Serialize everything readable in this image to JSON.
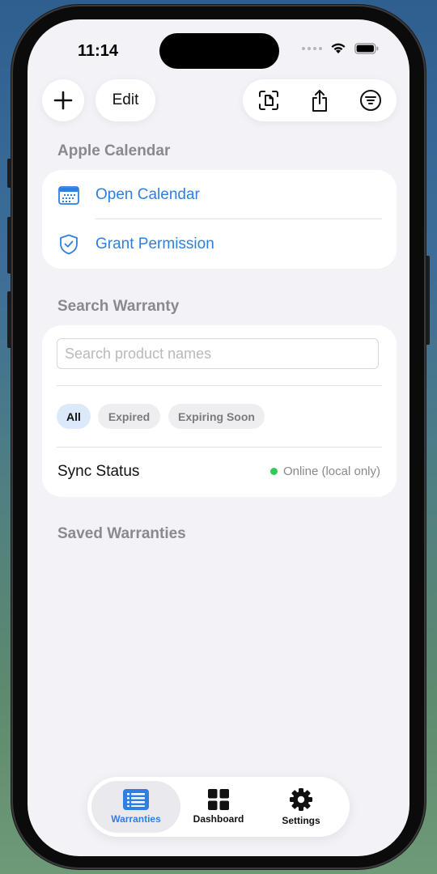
{
  "status_bar": {
    "time": "11:14"
  },
  "toolbar": {
    "add_icon": "plus-icon",
    "edit_label": "Edit",
    "scan_icon": "doc-scan-icon",
    "share_icon": "share-icon",
    "filter_icon": "filter-icon"
  },
  "calendar_section": {
    "header": "Apple Calendar",
    "items": [
      {
        "label": "Open Calendar",
        "icon": "calendar-icon"
      },
      {
        "label": "Grant Permission",
        "icon": "shield-check-icon"
      }
    ]
  },
  "search_section": {
    "header": "Search Warranty",
    "search_placeholder": "Search product names",
    "search_value": "",
    "filters": [
      "All",
      "Expired",
      "Expiring Soon"
    ],
    "selected_filter": "All",
    "sync_label": "Sync Status",
    "sync_value": "Online (local only)",
    "sync_color": "#34c759"
  },
  "saved_section": {
    "header": "Saved Warranties"
  },
  "tab_bar": {
    "tabs": [
      {
        "label": "Warranties",
        "icon": "list-icon",
        "active": true
      },
      {
        "label": "Dashboard",
        "icon": "grid-icon",
        "active": false
      },
      {
        "label": "Settings",
        "icon": "gear-icon",
        "active": false
      }
    ]
  },
  "colors": {
    "accent": "#2f7fe0",
    "background": "#f2f2f7"
  }
}
